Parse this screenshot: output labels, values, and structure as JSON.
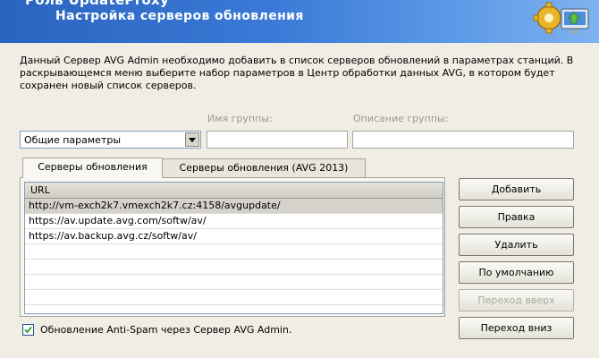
{
  "header": {
    "top_title": "Роль UpdateProxy",
    "title": "Настройка серверов обновления"
  },
  "description": "Данный Сервер AVG Admin необходимо добавить в список серверов обновлений в параметрах станций. В раскрывающемся меню выберите набор параметров в Центр обработки данных AVG, в котором будет сохранен новый список серверов.",
  "form": {
    "group_name_label": "Имя группы:",
    "group_desc_label": "Описание группы:",
    "preset_selected": "Общие параметры",
    "group_name_value": "",
    "group_desc_value": ""
  },
  "tabs": [
    {
      "label": "Серверы обновления",
      "active": true
    },
    {
      "label": "Серверы обновления (AVG 2013)",
      "active": false
    }
  ],
  "list": {
    "column": "URL",
    "rows": [
      "http://vm-exch2k7.vmexch2k7.cz:4158/avgupdate/",
      "https://av.update.avg.com/softw/av/",
      "https://av.backup.avg.cz/softw/av/"
    ]
  },
  "buttons": {
    "add": "Добавить",
    "edit": "Правка",
    "delete": "Удалить",
    "default": "По умолчанию",
    "move_up": "Переход вверх",
    "move_down": "Переход вниз"
  },
  "checkbox": {
    "label": "Обновление Anti-Spam через Сервер AVG Admin.",
    "checked": true
  },
  "colors": {
    "header_blue": "#2a64bf",
    "dialog_bg": "#f0eee4",
    "selected_row": "#d4d2ca"
  }
}
